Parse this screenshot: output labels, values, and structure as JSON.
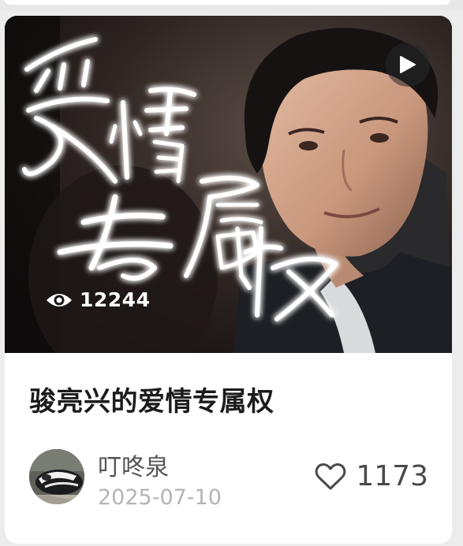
{
  "card": {
    "cover": {
      "overlay_title_lines": [
        "爱情",
        "专属权"
      ],
      "view_count": "12244",
      "view_icon": "eye-icon",
      "play_icon": "play-icon"
    },
    "title": "骏亮兴的爱情专属权",
    "author": {
      "name": "叮咚泉",
      "date": "2025-07-10",
      "avatar_icon": "avatar"
    },
    "likes": {
      "count": "1173",
      "icon": "heart-outline-icon"
    }
  }
}
